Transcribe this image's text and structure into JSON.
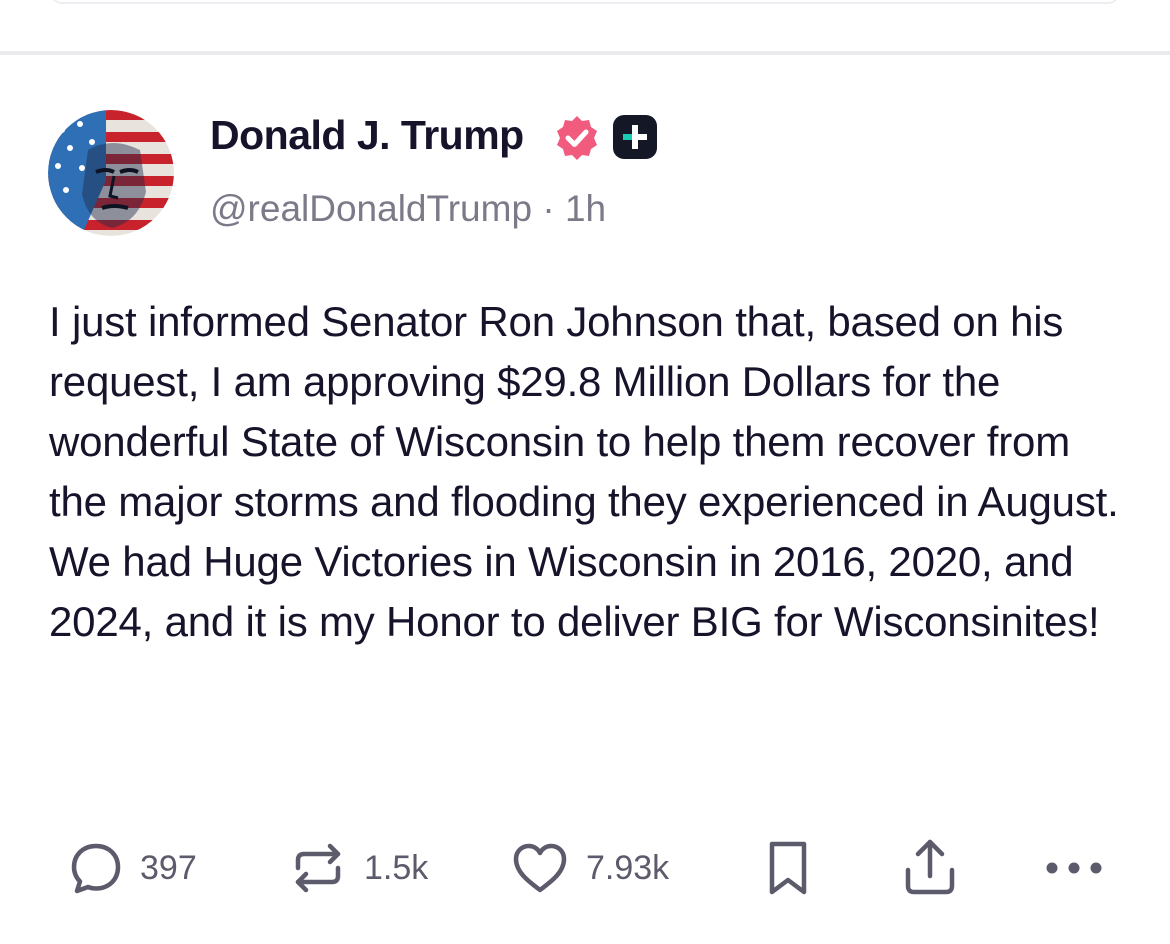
{
  "post": {
    "author": {
      "display_name": "Donald J. Trump",
      "handle": "@realDonaldTrump",
      "separator": "·",
      "time_ago": "1h"
    },
    "icons": {
      "verified": "verified-badge-icon",
      "subscribe": "plus-icon"
    },
    "colors": {
      "verified_badge": "#f15b7e",
      "text": "#16132b",
      "muted": "#7b7a88",
      "action": "#5c5b6c"
    },
    "body": "I just informed Senator Ron Johnson that, based on his request, I am approving $29.8 Million Dollars for the wonderful State of Wisconsin to help them recover from the major storms and flooding they experienced in August. We had Huge Victories in Wisconsin in 2016, 2020, and 2024, and it is my Honor to deliver BIG for Wisconsinites!",
    "actions": {
      "replies": "397",
      "reposts": "1.5k",
      "likes": "7.93k"
    }
  }
}
